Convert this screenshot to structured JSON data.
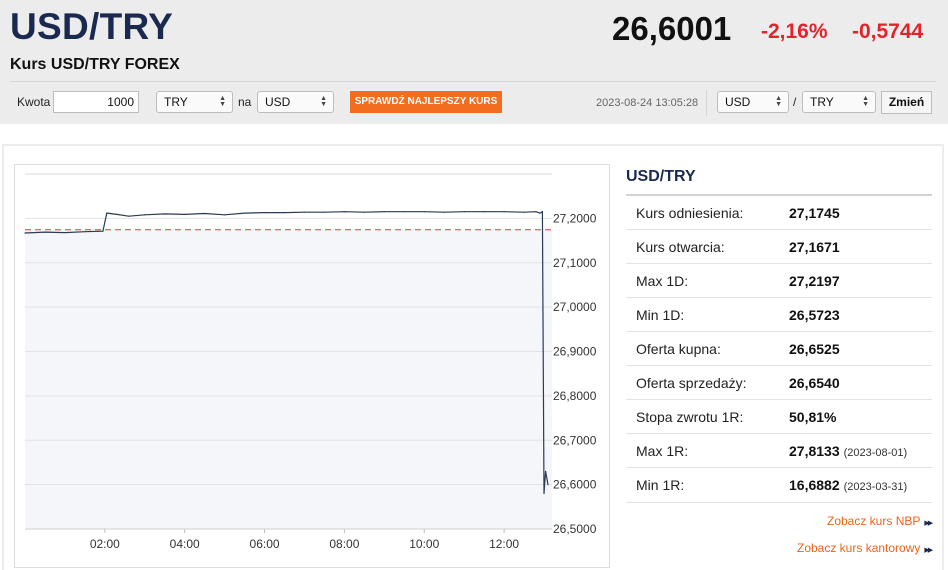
{
  "header": {
    "title": "USD/TRY",
    "subtitle": "Kurs USD/TRY FOREX",
    "price": "26,6001",
    "change_pct": "-2,16%",
    "change_abs": "-0,5744"
  },
  "converter": {
    "amount_label": "Kwota",
    "amount_value": "1000",
    "from_currency": "TRY",
    "na_label": "na",
    "to_currency": "USD",
    "best_rate_button": "SPRAWDŹ NAJLEPSZY KURS",
    "timestamp": "2023-08-24 13:05:28",
    "pair_from": "USD",
    "pair_separator": "/",
    "pair_to": "TRY",
    "change_button": "Zmień"
  },
  "stats": {
    "title": "USD/TRY",
    "rows": [
      {
        "label": "Kurs odniesienia:",
        "value": "27,1745",
        "date": ""
      },
      {
        "label": "Kurs otwarcia:",
        "value": "27,1671",
        "date": ""
      },
      {
        "label": "Max 1D:",
        "value": "27,2197",
        "date": ""
      },
      {
        "label": "Min 1D:",
        "value": "26,5723",
        "date": ""
      },
      {
        "label": "Oferta kupna:",
        "value": "26,6525",
        "date": ""
      },
      {
        "label": "Oferta sprzedaży:",
        "value": "26,6540",
        "date": ""
      },
      {
        "label": "Stopa zwrotu 1R:",
        "value": "50,81%",
        "date": ""
      },
      {
        "label": "Max 1R:",
        "value": "27,8133",
        "date": "(2023-08-01)"
      },
      {
        "label": "Min 1R:",
        "value": "16,6882",
        "date": "(2023-03-31)"
      }
    ]
  },
  "links": {
    "nbp": "Zobacz kurs NBP",
    "kantor": "Zobacz kurs kantorowy"
  },
  "colors": {
    "accent_orange": "#f36d21",
    "negative_red": "#e0242b",
    "title_navy": "#1a2a4f",
    "line_color": "#2b3a55",
    "reference_line": "#e53935"
  },
  "chart_data": {
    "type": "line",
    "x_tick_labels": [
      "02:00",
      "04:00",
      "06:00",
      "08:00",
      "10:00",
      "12:00"
    ],
    "y_tick_labels": [
      "27,2000",
      "27,1000",
      "27,0000",
      "26,9000",
      "26,8000",
      "26,7000",
      "26,6000",
      "26,5000"
    ],
    "y_ticks": [
      27.2,
      27.1,
      27.0,
      26.9,
      26.8,
      26.7,
      26.6,
      26.5
    ],
    "ylim": [
      26.5,
      27.3
    ],
    "xlim": [
      0,
      13.2
    ],
    "reference_value": 27.1745,
    "grid": true,
    "series": [
      {
        "x": [
          0.0,
          0.5,
          1.0,
          1.5,
          1.95,
          2.05,
          2.3,
          2.6,
          3.0,
          3.5,
          4.0,
          4.5,
          5.0,
          5.5,
          6.0,
          6.5,
          7.0,
          7.5,
          8.0,
          8.5,
          9.0,
          9.5,
          10.0,
          10.5,
          11.0,
          11.5,
          12.0,
          12.5,
          12.8,
          12.9,
          12.96,
          13.0,
          13.04,
          13.1
        ],
        "values": [
          27.167,
          27.169,
          27.168,
          27.17,
          27.171,
          27.212,
          27.209,
          27.205,
          27.208,
          27.21,
          27.209,
          27.211,
          27.208,
          27.212,
          27.213,
          27.213,
          27.214,
          27.214,
          27.215,
          27.214,
          27.215,
          27.215,
          27.215,
          27.214,
          27.215,
          27.215,
          27.215,
          27.214,
          27.215,
          27.212,
          27.215,
          26.58,
          26.63,
          26.6
        ]
      }
    ]
  }
}
